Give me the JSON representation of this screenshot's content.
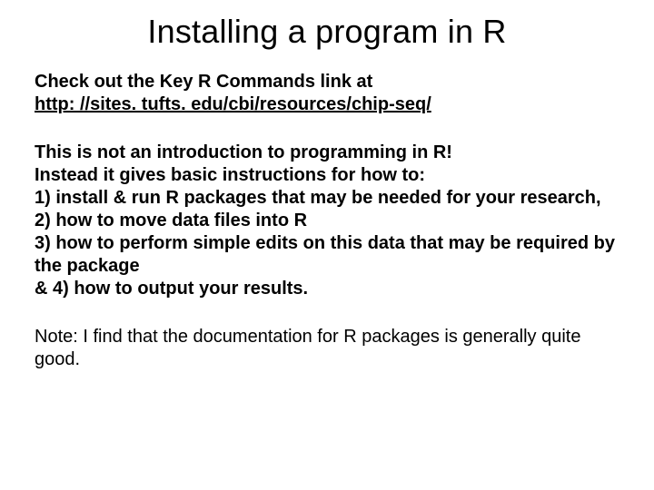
{
  "title": "Installing a program in R",
  "intro": {
    "lead": "Check out the Key R Commands link at",
    "url": "http: //sites. tufts. edu/cbi/resources/chip-seq/"
  },
  "body": {
    "line1": "This is not an introduction to programming in R!",
    "line2": "Instead it gives basic instructions for how to:",
    "item1": "1) install & run R packages that may be needed for your research,",
    "item2": "2) how to move data files into R",
    "item3": "3) how to perform simple edits on this data that may be required by the package",
    "item4": "& 4) how to output your results."
  },
  "note": "Note: I find that the documentation for R packages is generally quite good."
}
